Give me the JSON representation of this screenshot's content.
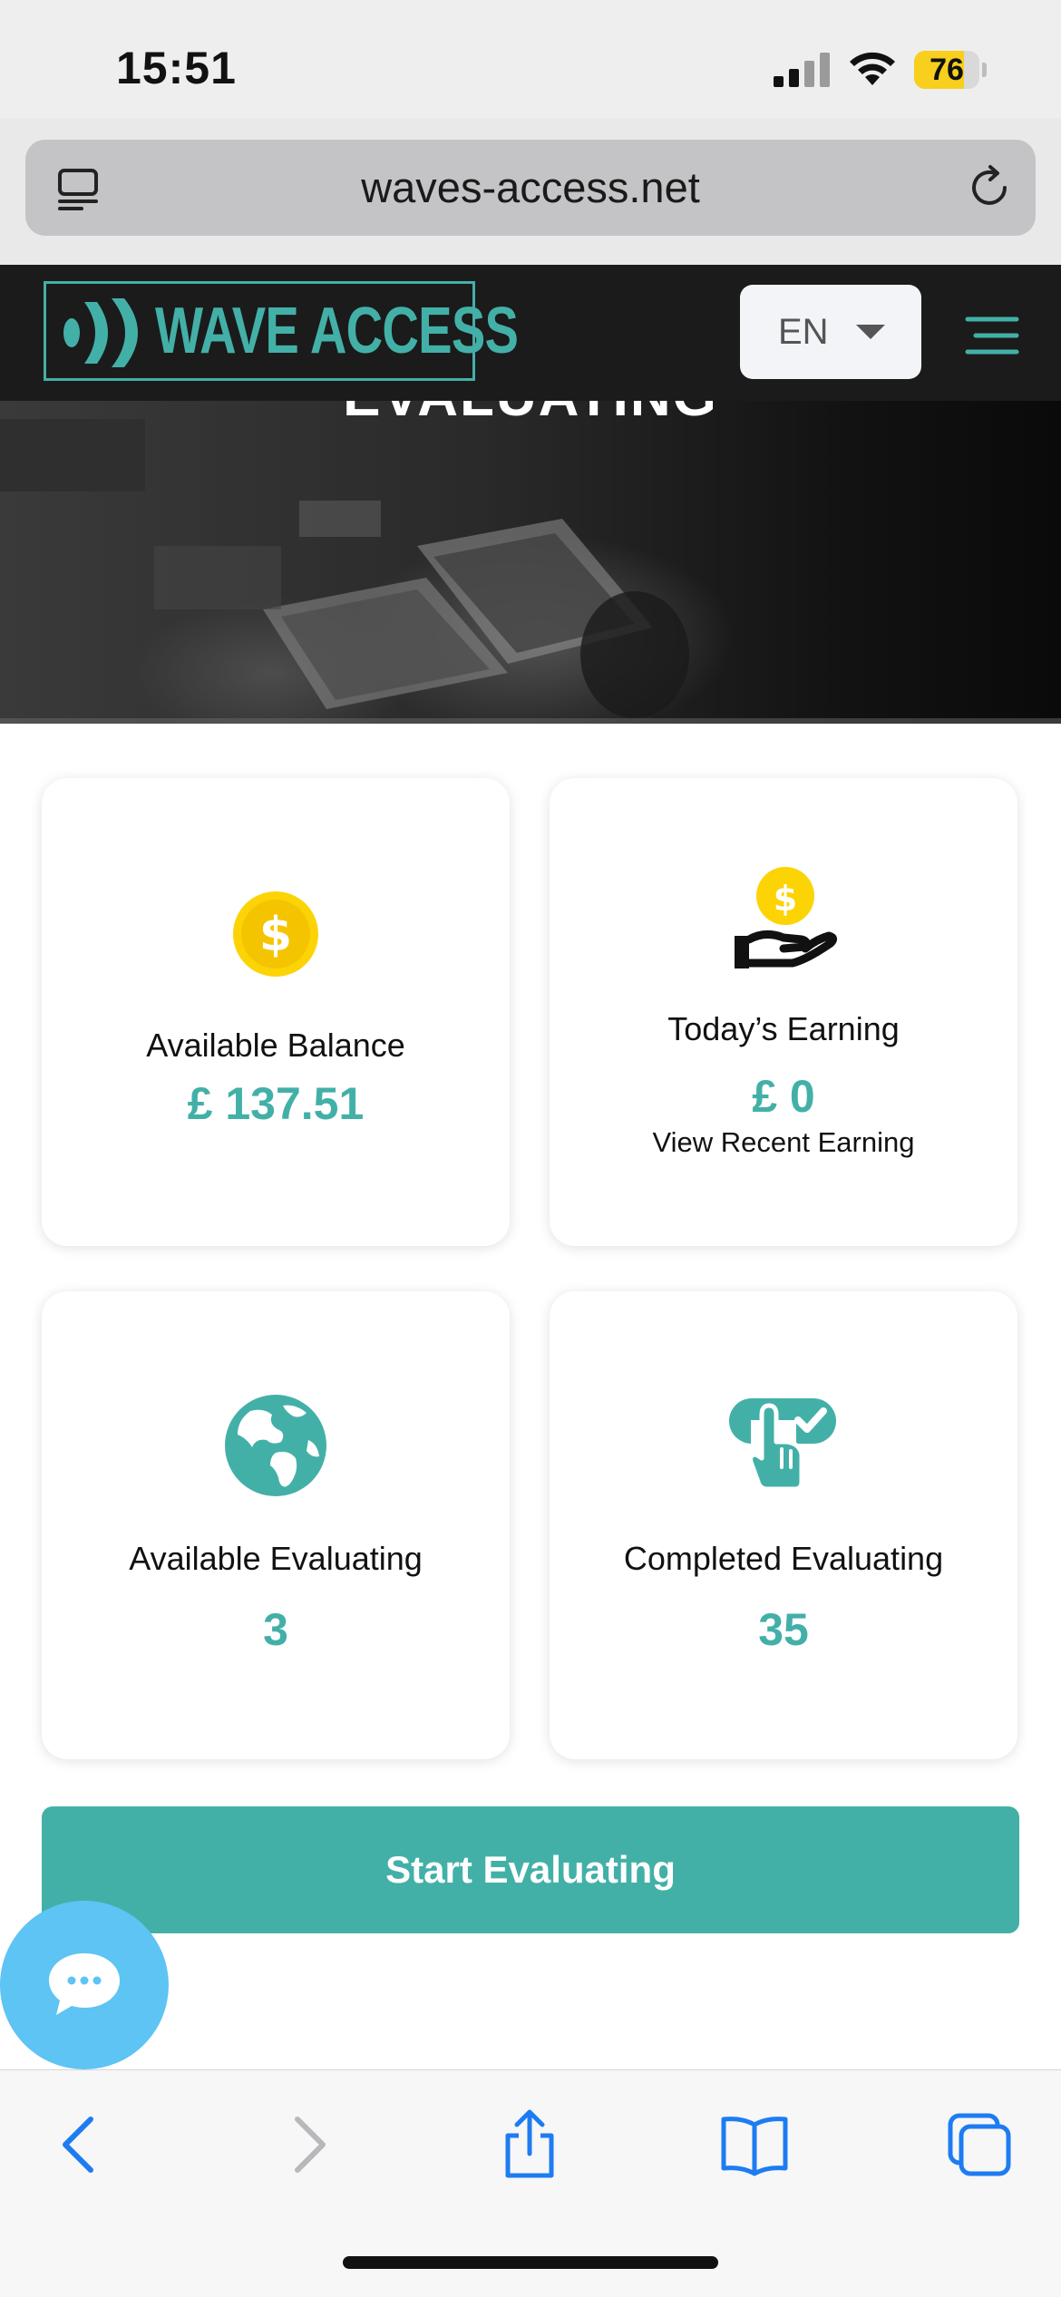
{
  "status_bar": {
    "time": "15:51",
    "battery": "76",
    "battery_level": 0.76
  },
  "browser": {
    "url": "waves-access.net"
  },
  "header": {
    "logo_text": "WAVE ACCESS",
    "language": "EN"
  },
  "hero": {
    "title": "EVALUATING"
  },
  "cards": {
    "balance": {
      "label": "Available Balance",
      "value": "£ 137.51"
    },
    "today": {
      "label": "Today’s Earning",
      "value": "£ 0",
      "link": "View Recent Earning"
    },
    "available": {
      "label": "Available Evaluating",
      "value": "3"
    },
    "completed": {
      "label": "Completed Evaluating",
      "value": "35"
    }
  },
  "actions": {
    "start_label": "Start Evaluating"
  },
  "colors": {
    "accent": "#43b0a8",
    "gold": "#fcd405",
    "chat": "#5dc4f4",
    "ios_blue": "#1e7cf2"
  },
  "icons": {
    "balance": "dollar-coin-icon",
    "today": "hand-coin-icon",
    "available": "globe-icon",
    "completed": "tap-check-icon"
  }
}
